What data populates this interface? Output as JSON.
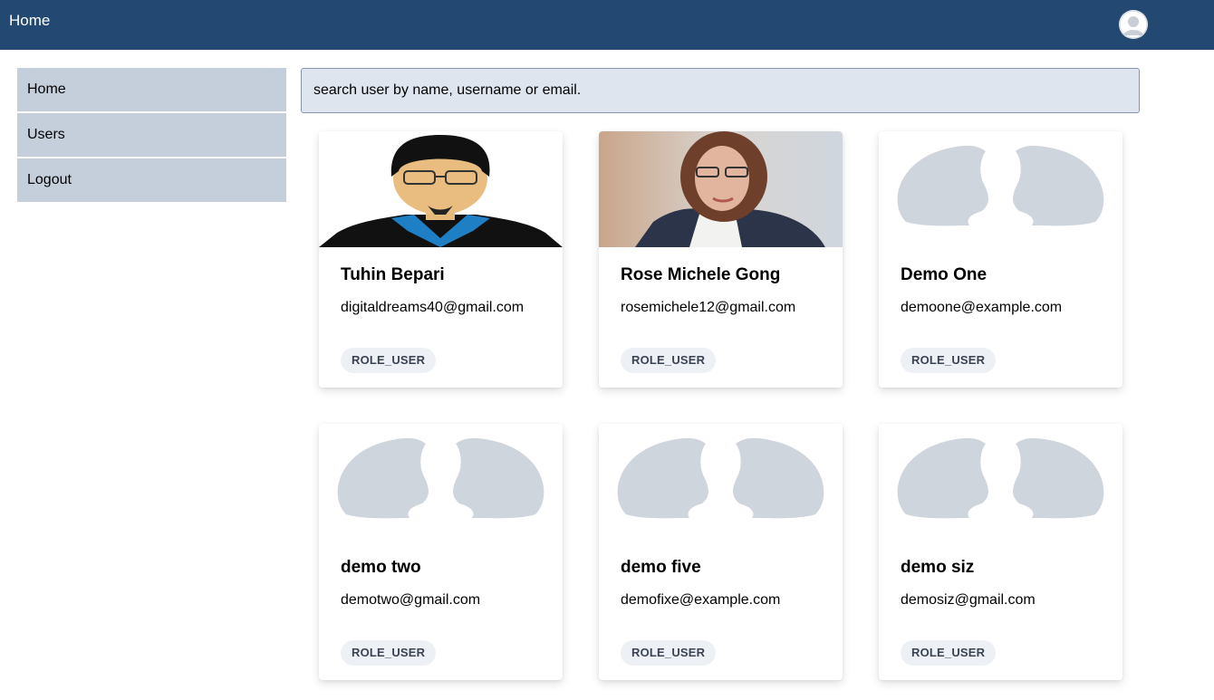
{
  "topbar": {
    "home_label": "Home",
    "bg": "#234872"
  },
  "sidebar": {
    "items": [
      {
        "label": "Home"
      },
      {
        "label": "Users"
      },
      {
        "label": "Logout"
      }
    ]
  },
  "search": {
    "placeholder": "search user by name, username or email."
  },
  "users": [
    {
      "name": "Tuhin Bepari",
      "email": "digitaldreams40@gmail.com",
      "role": "ROLE_USER",
      "avatar": "cartoon-avatar"
    },
    {
      "name": "Rose Michele Gong",
      "email": "rosemichele12@gmail.com",
      "role": "ROLE_USER",
      "avatar": "photo-avatar"
    },
    {
      "name": "Demo One",
      "email": "demoone@example.com",
      "role": "ROLE_USER",
      "avatar": "default-avatar"
    },
    {
      "name": "demo two",
      "email": "demotwo@gmail.com",
      "role": "ROLE_USER",
      "avatar": "default-avatar"
    },
    {
      "name": "demo five",
      "email": "demofixe@example.com",
      "role": "ROLE_USER",
      "avatar": "default-avatar"
    },
    {
      "name": "demo siz",
      "email": "demosiz@gmail.com",
      "role": "ROLE_USER",
      "avatar": "default-avatar"
    }
  ]
}
